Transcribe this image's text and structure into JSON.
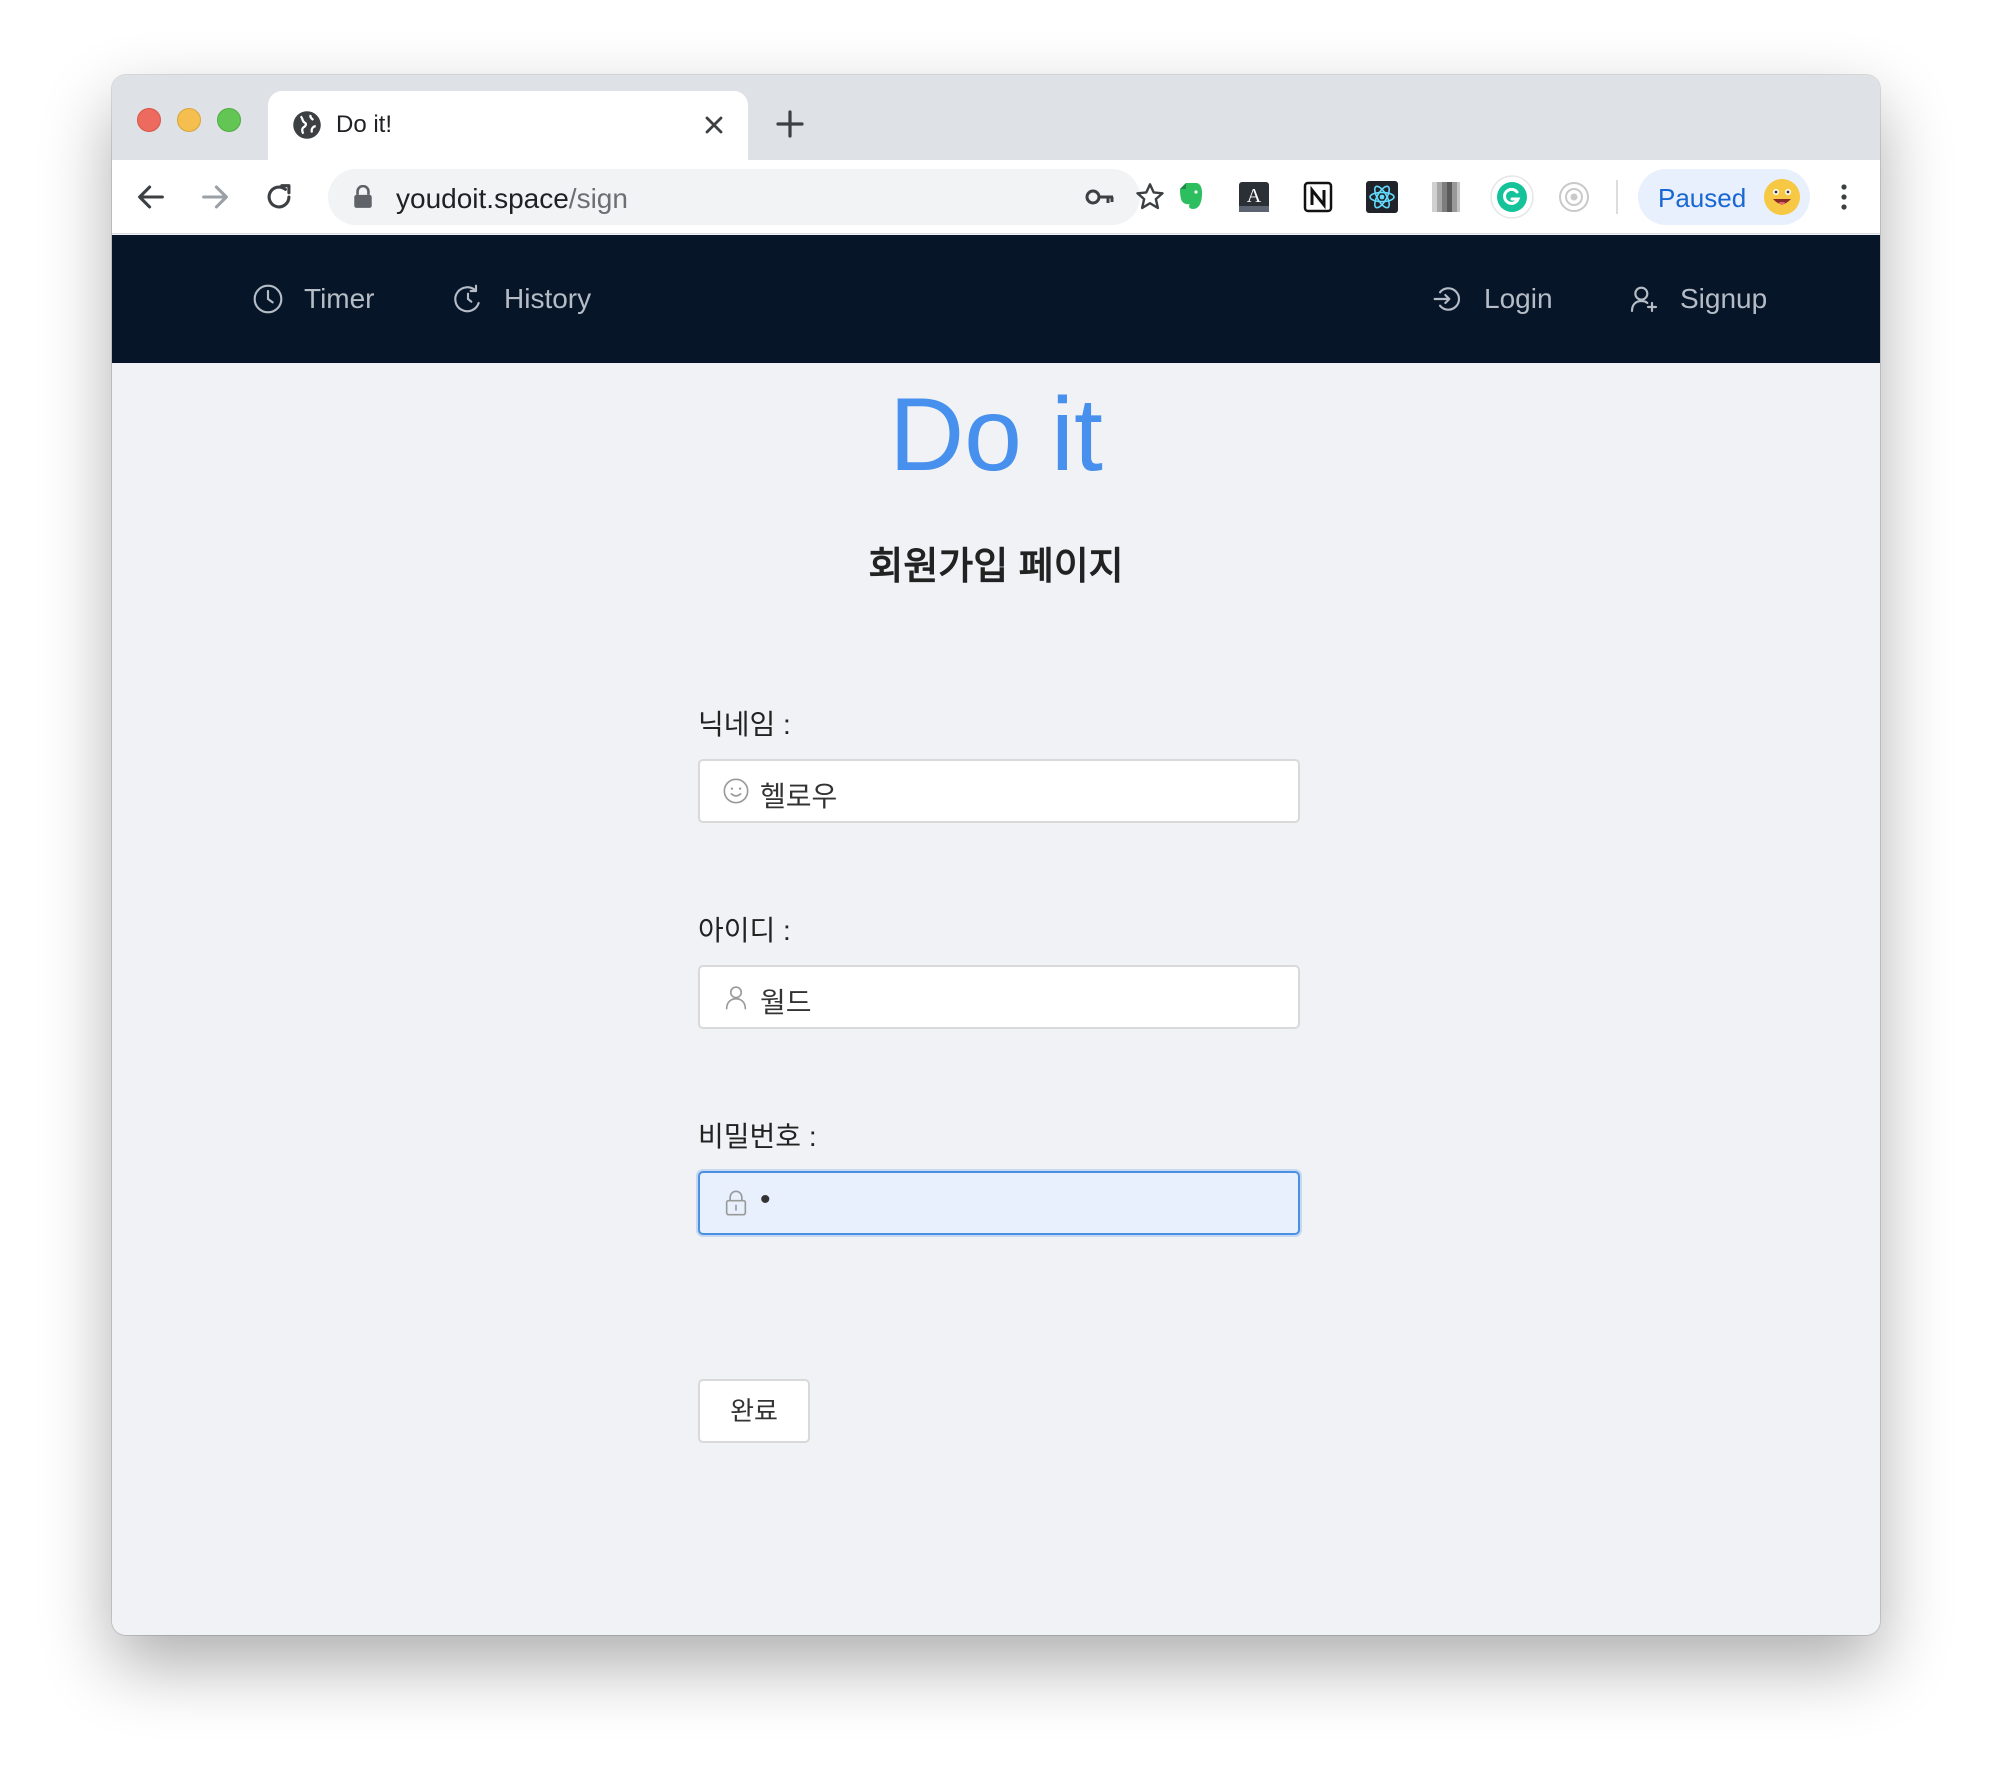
{
  "browser": {
    "tab": {
      "title": "Do it!"
    },
    "omnibox": {
      "url_host": "youdoit.space",
      "url_path": "/sign"
    },
    "profile": {
      "label": "Paused"
    }
  },
  "nav": {
    "left": [
      {
        "label": "Timer",
        "icon": "clock-icon"
      },
      {
        "label": "History",
        "icon": "history-icon"
      }
    ],
    "right": [
      {
        "label": "Login",
        "icon": "login-icon"
      },
      {
        "label": "Signup",
        "icon": "user-add-icon"
      }
    ]
  },
  "page": {
    "logo": "Do it",
    "subtitle": "회원가입 페이지",
    "fields": [
      {
        "label": "닉네임 :",
        "value": "헬로우",
        "icon": "smile-icon"
      },
      {
        "label": "아이디 :",
        "value": "월드",
        "icon": "user-icon"
      },
      {
        "label": "비밀번호 :",
        "value": "•",
        "icon": "lock-icon"
      }
    ],
    "submit_label": "완료"
  },
  "colors": {
    "nav_bg": "#061528",
    "accent": "#4790ee",
    "page_bg": "#f0f2f5",
    "focus_border": "#4a90e2"
  }
}
